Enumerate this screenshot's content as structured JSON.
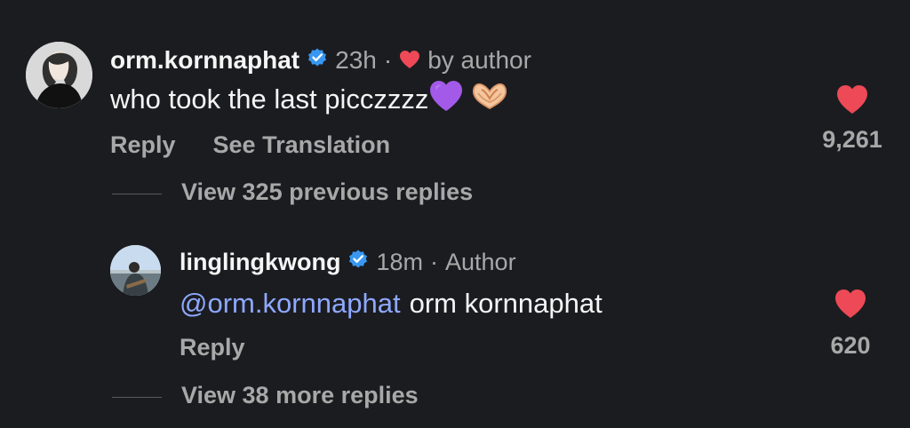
{
  "comment1": {
    "username": "orm.kornnaphat",
    "time": "23h",
    "separator": "·",
    "liked_by": "by author",
    "text": "who took the last picczzzz",
    "reply_label": "Reply",
    "translate_label": "See Translation",
    "like_count": "9,261",
    "liked": true
  },
  "view_previous": {
    "label": "View 325 previous replies"
  },
  "comment2": {
    "username": "linglingkwong",
    "time": "18m",
    "separator": "·",
    "role": "Author",
    "mention": "@orm.kornnaphat",
    "text": "orm kornnaphat",
    "reply_label": "Reply",
    "like_count": "620",
    "liked": true
  },
  "view_more": {
    "label": "View 38 more replies"
  },
  "colors": {
    "background": "#1b1c20",
    "heart": "#ed4956",
    "verified": "#3897f0",
    "mention": "#8ea8ff",
    "secondary_text": "#a8a8a8"
  },
  "icons": {
    "verified": "verified-badge-icon",
    "heart": "heart-icon",
    "purple_heart": "purple-heart-emoji",
    "heart_hands": "heart-hands-emoji"
  }
}
